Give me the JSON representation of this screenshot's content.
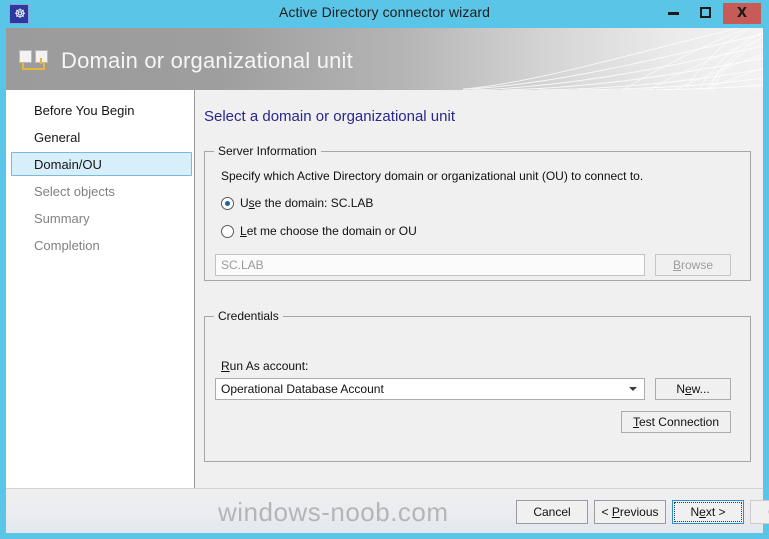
{
  "window": {
    "title": "Active Directory connector wizard",
    "app_icon": "app-logo-icon",
    "minimize_label": "Minimize",
    "maximize_label": "Maximize",
    "close_label": "X",
    "titlebar_color": "#5bc5e8",
    "close_button_color": "#c75b57"
  },
  "header": {
    "title": "Domain or organizational unit",
    "icon": "domain-ou-icon",
    "accent_color": "#e8b43a"
  },
  "sidebar": {
    "items": [
      {
        "label": "Before You Begin",
        "state": "visited"
      },
      {
        "label": "General",
        "state": "visited"
      },
      {
        "label": "Domain/OU",
        "state": "selected"
      },
      {
        "label": "Select objects",
        "state": "upcoming"
      },
      {
        "label": "Summary",
        "state": "upcoming"
      },
      {
        "label": "Completion",
        "state": "upcoming"
      }
    ],
    "selected_color": "#d7eefb"
  },
  "content": {
    "heading": "Select a domain or organizational unit",
    "heading_color": "#27278c",
    "server_group": {
      "legend": "Server Information",
      "description": "Specify which Active Directory domain or organizational unit (OU) to connect to.",
      "radios": [
        {
          "label_pre": "U",
          "label_acc": "s",
          "label_post": "e the domain: SC.LAB",
          "checked": true
        },
        {
          "label_pre": "",
          "label_acc": "L",
          "label_post": "et me choose the domain or OU",
          "checked": false
        }
      ],
      "domain_field": {
        "value": "SC.LAB",
        "placeholder": "SC.LAB",
        "disabled": true
      },
      "browse_button": {
        "label_pre": "",
        "label_acc": "B",
        "label_post": "rowse",
        "disabled": true
      }
    },
    "credentials_group": {
      "legend": "Credentials",
      "run_as_label_pre": "",
      "run_as_label_acc": "R",
      "run_as_label_post": "un As account:",
      "run_as_value": "Operational Database Account",
      "new_button": {
        "label_pre": "N",
        "label_acc": "e",
        "label_post": "w..."
      },
      "test_button": {
        "label_pre": "",
        "label_acc": "T",
        "label_post": "est Connection"
      }
    }
  },
  "footer": {
    "cancel": "Cancel",
    "previous_pre": "< ",
    "previous_acc": "P",
    "previous_post": "revious",
    "next_pre": "N",
    "next_acc": "e",
    "next_post": "xt >",
    "create": "Create",
    "create_disabled": true,
    "next_focused": true
  },
  "watermark": "windows-noob.com"
}
